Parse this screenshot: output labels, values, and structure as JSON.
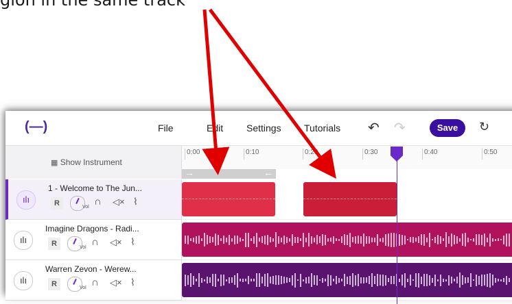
{
  "caption": "gion in the same track",
  "app": {
    "logo": "(—)",
    "menu": [
      "File",
      "Edit",
      "Settings",
      "Tutorials"
    ],
    "save_label": "Save",
    "undo_icon": "undo-icon",
    "redo_icon": "redo-icon",
    "restore_icon": "history-icon"
  },
  "header": {
    "show_instrument_icon": "grid-icon",
    "show_instrument": "Show Instrument"
  },
  "ruler": {
    "ticks": [
      "0:00",
      "0:10",
      "0:20",
      "0:30",
      "0:40",
      "0:50"
    ]
  },
  "tracks": [
    {
      "name": "1 - Welcome to The Jun...",
      "r_label": "R",
      "vol_label": "Vol",
      "color": "#e03049"
    },
    {
      "name": "Imagine Dragons - Radi...",
      "r_label": "R",
      "vol_label": "Vol",
      "color": "#b0125e"
    },
    {
      "name": "Warren Zevon - Werew...",
      "r_label": "R",
      "vol_label": "Vol",
      "color": "#4a1a6a"
    }
  ],
  "colors": {
    "accent": "#6a2ac8",
    "annotation_arrow": "#e00000",
    "region_selected": "#e03049",
    "region_second": "#cc1f3a",
    "track2": "#b0125e",
    "track3": "#5a1470"
  }
}
